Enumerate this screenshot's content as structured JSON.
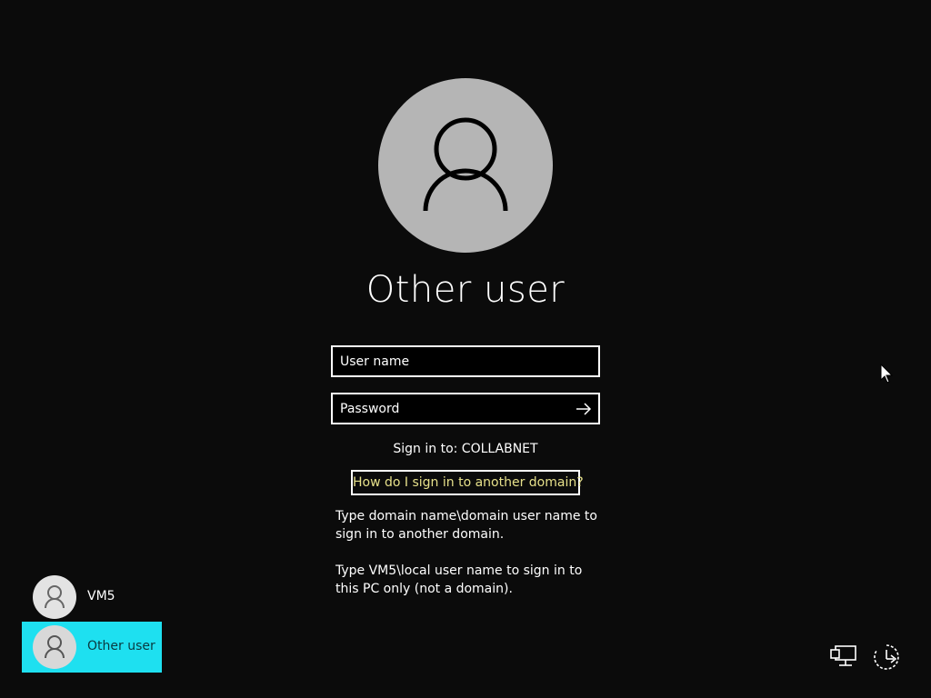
{
  "login": {
    "title": "Other user",
    "username_placeholder": "User name",
    "password_placeholder": "Password",
    "sign_in_to": "Sign in to: COLLABNET",
    "help_link": "How do I sign in to another domain?",
    "help_text_1": "Type domain name\\domain user name to sign in to another domain.",
    "help_text_2": "Type VM5\\local user name to sign in to this PC only (not a domain)."
  },
  "users": [
    {
      "name": "VM5",
      "selected": false
    },
    {
      "name": "Other user",
      "selected": true
    }
  ],
  "system_icons": [
    "network-icon",
    "power-icon"
  ],
  "colors": {
    "background": "#0b0b0b",
    "avatar": "#b5b5b5",
    "selected_tile": "#1ee0f0",
    "link_text": "#e6e08a"
  }
}
